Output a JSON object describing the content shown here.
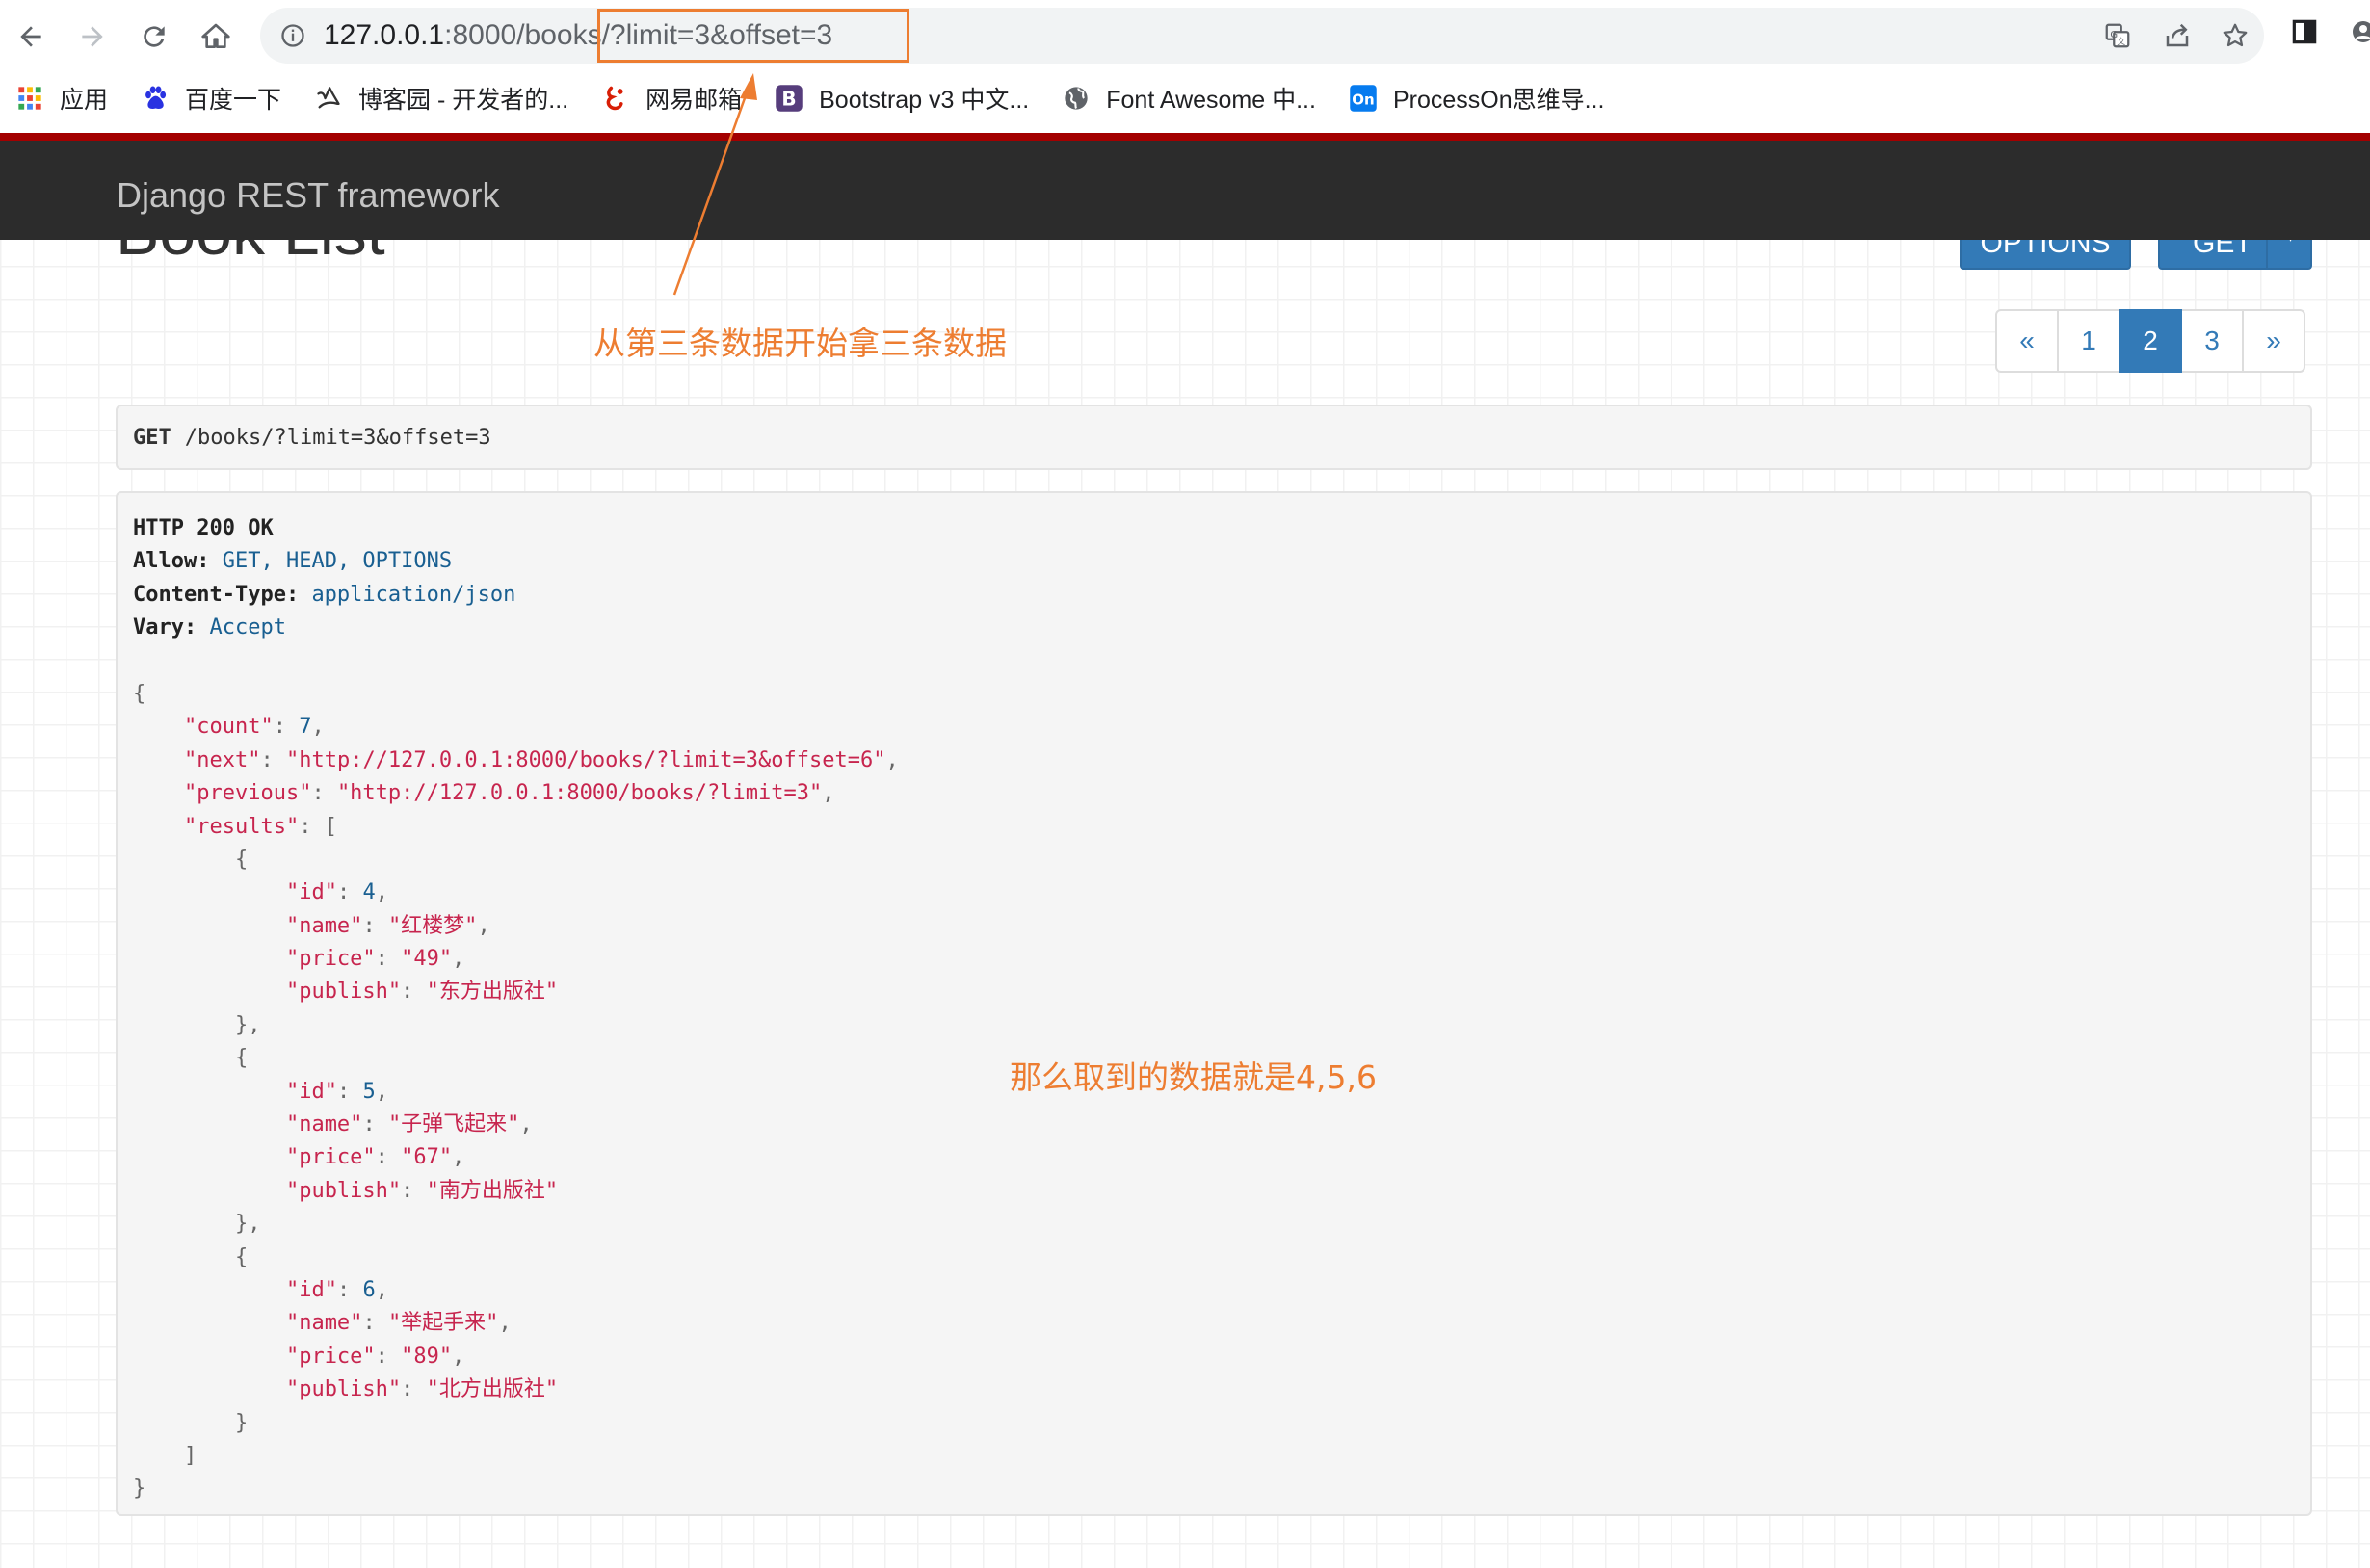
{
  "browser": {
    "url_host": "127.0.0.1",
    "url_port_path": ":8000/books/",
    "url_query": "?limit=3&offset=3",
    "bookmarks": [
      {
        "label": "应用",
        "icon": "apps-grid-icon"
      },
      {
        "label": "百度一下",
        "icon": "baidu-paw-icon"
      },
      {
        "label": "博客园 - 开发者的...",
        "icon": "cnblogs-icon"
      },
      {
        "label": "网易邮箱",
        "icon": "netease-mail-icon"
      },
      {
        "label": "Bootstrap v3 中文...",
        "icon": "bootstrap-icon"
      },
      {
        "label": "Font Awesome 中...",
        "icon": "globe-icon"
      },
      {
        "label": "ProcessOn思维导...",
        "icon": "processon-icon"
      }
    ]
  },
  "drf": {
    "brand": "Django REST framework",
    "page_title": "Book List",
    "options_label": "OPTIONS",
    "get_label": "GET"
  },
  "annotations": {
    "note_top": "从第三条数据开始拿三条数据",
    "note_middle": "那么取到的数据就是4,5,6",
    "color": "#ed7d31"
  },
  "pagination": {
    "prev": "«",
    "pages": [
      "1",
      "2",
      "3"
    ],
    "active": "2",
    "next": "»"
  },
  "request": {
    "method": "GET",
    "path": "/books/?limit=3&offset=3"
  },
  "response": {
    "status": "HTTP 200 OK",
    "headers": [
      {
        "name": "Allow:",
        "value": "GET, HEAD, OPTIONS"
      },
      {
        "name": "Content-Type:",
        "value": "application/json"
      },
      {
        "name": "Vary:",
        "value": "Accept"
      }
    ],
    "count": "7",
    "next": "\"http://127.0.0.1:8000/books/?limit=3&offset=6\"",
    "previous": "\"http://127.0.0.1:8000/books/?limit=3\"",
    "results": [
      {
        "id": "4",
        "name": "\"红楼梦\"",
        "price": "\"49\"",
        "publish": "\"东方出版社\""
      },
      {
        "id": "5",
        "name": "\"子弹飞起来\"",
        "price": "\"67\"",
        "publish": "\"南方出版社\""
      },
      {
        "id": "6",
        "name": "\"举起手来\"",
        "price": "\"89\"",
        "publish": "\"北方出版社\""
      }
    ]
  },
  "colors": {
    "drf_blue": "#337ab7",
    "navbar_dark": "#2c2c2c",
    "navbar_red": "#a30000",
    "json_string": "#c7254e",
    "json_literal": "#195f91"
  }
}
